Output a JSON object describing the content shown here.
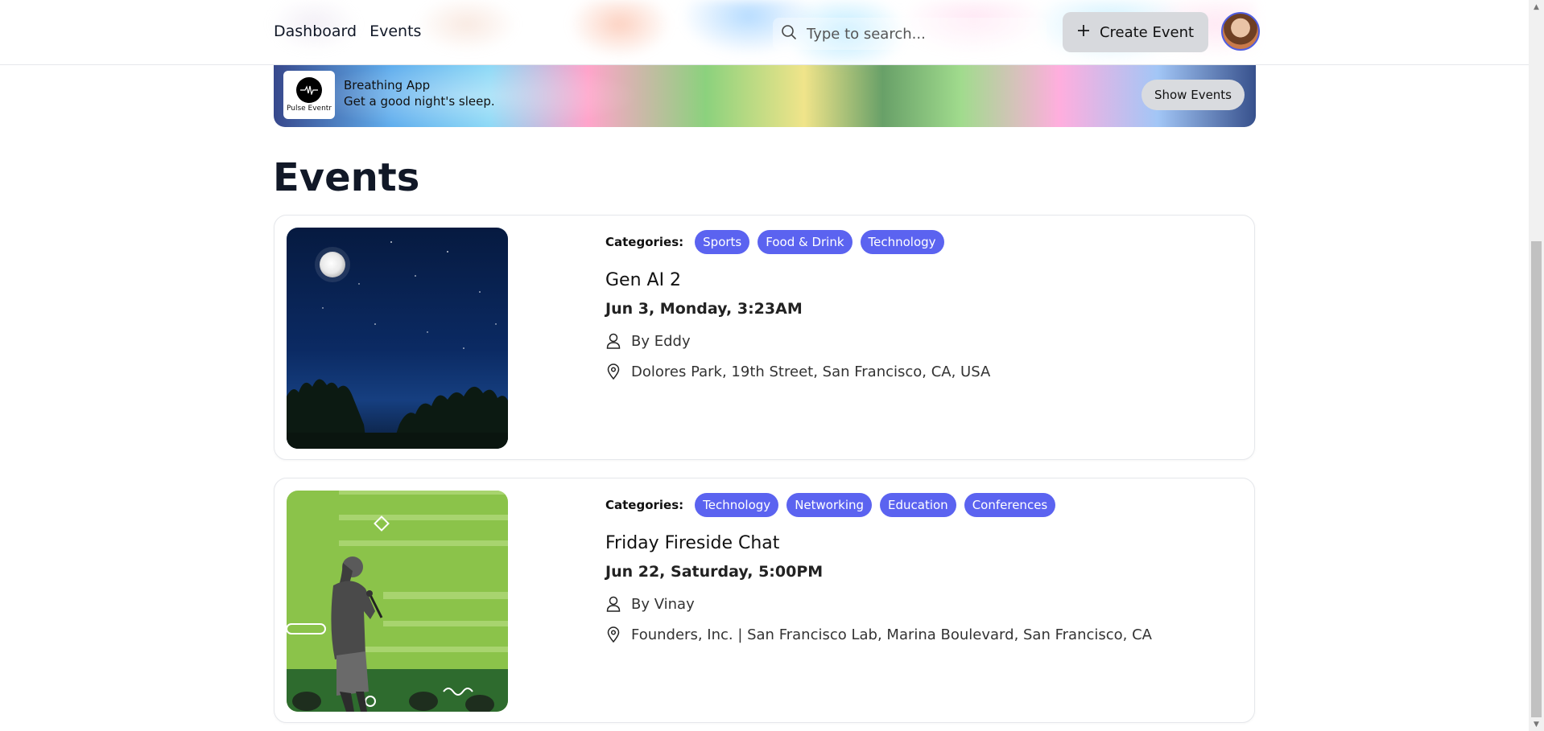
{
  "header": {
    "nav": [
      "Dashboard",
      "Events"
    ],
    "search_placeholder": "Type to search...",
    "create_label": "Create Event"
  },
  "banner": {
    "logo_text": "Pulse Eventr",
    "title": "Breathing App",
    "subtitle": "Get a good night's sleep.",
    "button_label": "Show Events"
  },
  "page": {
    "title": "Events"
  },
  "events": [
    {
      "categories_label": "Categories:",
      "categories": [
        "Sports",
        "Food & Drink",
        "Technology"
      ],
      "title": "Gen AI 2",
      "date": "Jun 3, Monday, 3:23AM",
      "organizer": "By Eddy",
      "location": "Dolores Park, 19th Street, San Francisco, CA, USA"
    },
    {
      "categories_label": "Categories:",
      "categories": [
        "Technology",
        "Networking",
        "Education",
        "Conferences"
      ],
      "title": "Friday Fireside Chat",
      "date": "Jun 22, Saturday, 5:00PM",
      "organizer": "By Vinay",
      "location": "Founders, Inc. | San Francisco Lab, Marina Boulevard, San Francisco, CA"
    }
  ],
  "colors": {
    "tag": "#5b63f0",
    "accent": "#4f5de0"
  }
}
